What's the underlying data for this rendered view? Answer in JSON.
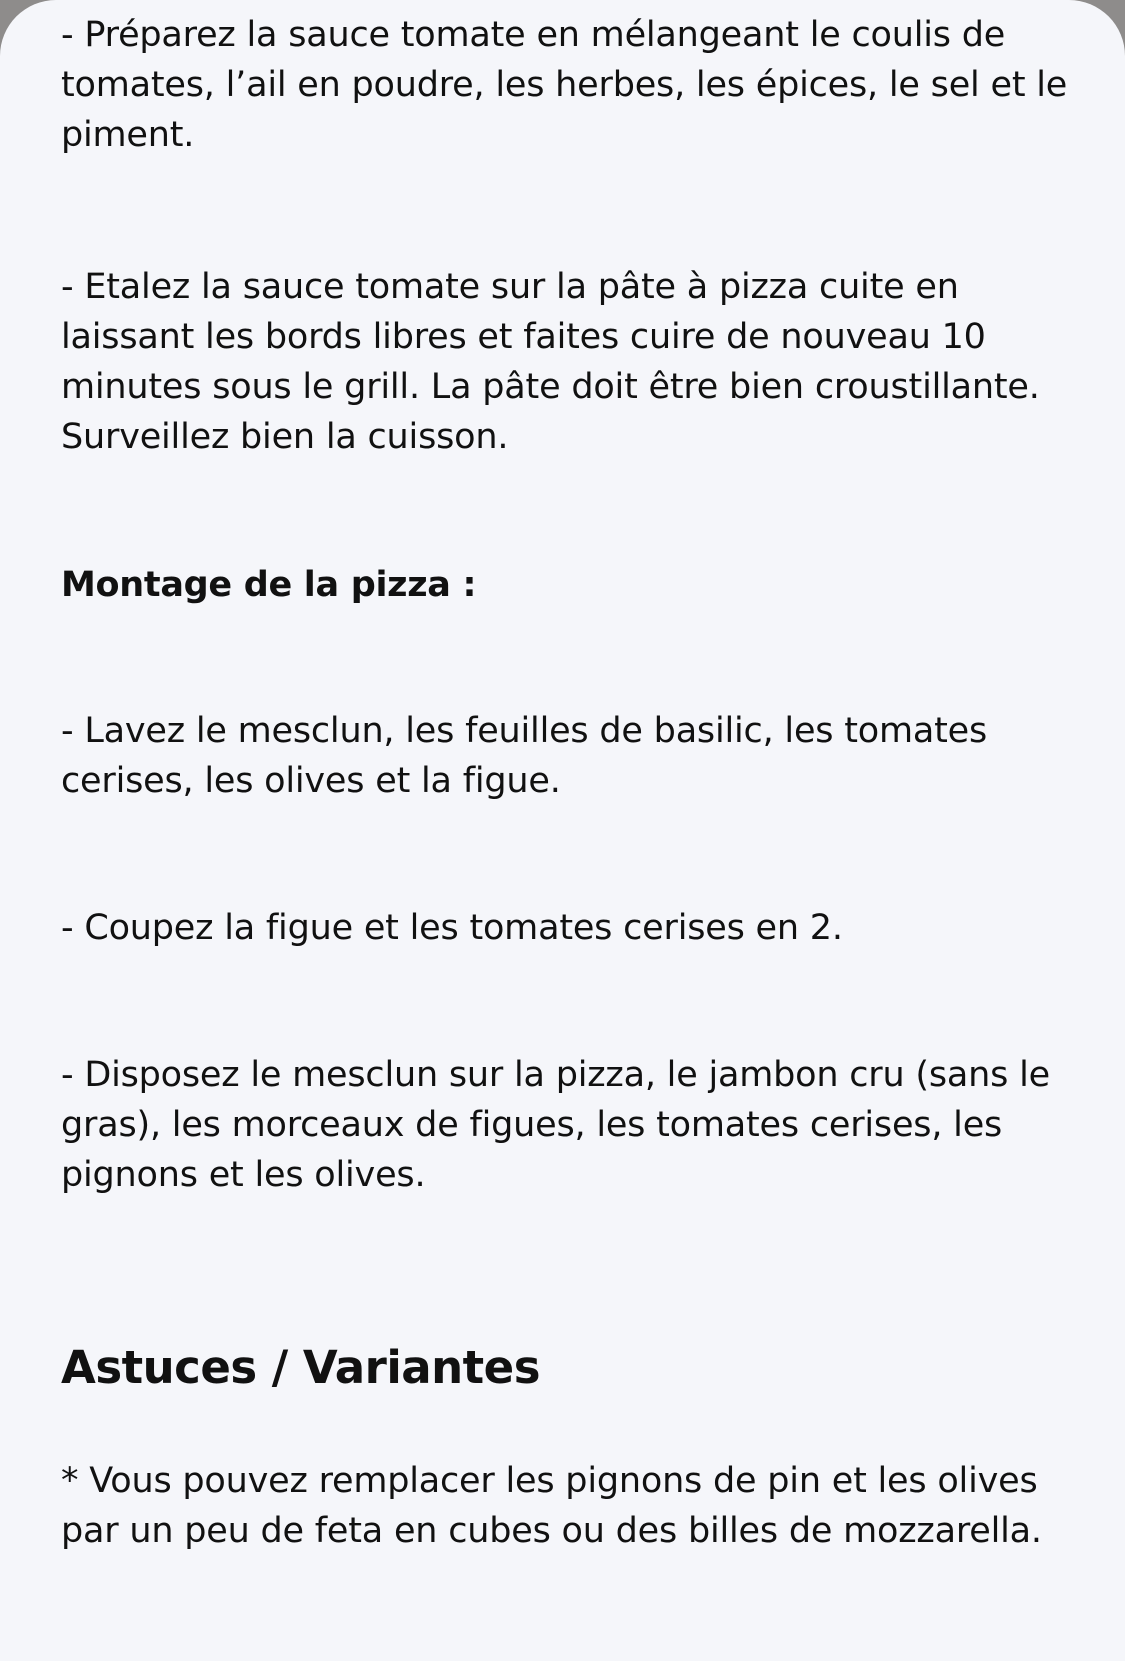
{
  "recipe": {
    "step_sauce": "- Préparez la sauce tomate en mélangeant le coulis de tomates, l’ail en poudre, les herbes, les épices, le sel et le piment.",
    "step_spread": "- Etalez la sauce tomate sur la pâte à pizza cuite en laissant les bords libres et faites cuire de nouveau 10 minutes sous le grill. La pâte doit être bien croustillante. Surveillez bien la cuisson.",
    "assembly_heading": "Montage de la pizza :",
    "step_wash": "- Lavez le mesclun, les feuilles de basilic, les tomates cerises, les olives et la figue.",
    "step_cut": "- Coupez la figue et les tomates cerises en 2.",
    "step_arrange": "- Disposez le mesclun sur la pizza, le jambon cru (sans le gras), les morceaux de figues, les tomates cerises, les pignons et les olives.",
    "tips_heading": "Astuces / Variantes",
    "tip_1": "* Vous pouvez remplacer les pignons de pin et les olives par un peu de feta en cubes ou des billes de mozzarella."
  }
}
